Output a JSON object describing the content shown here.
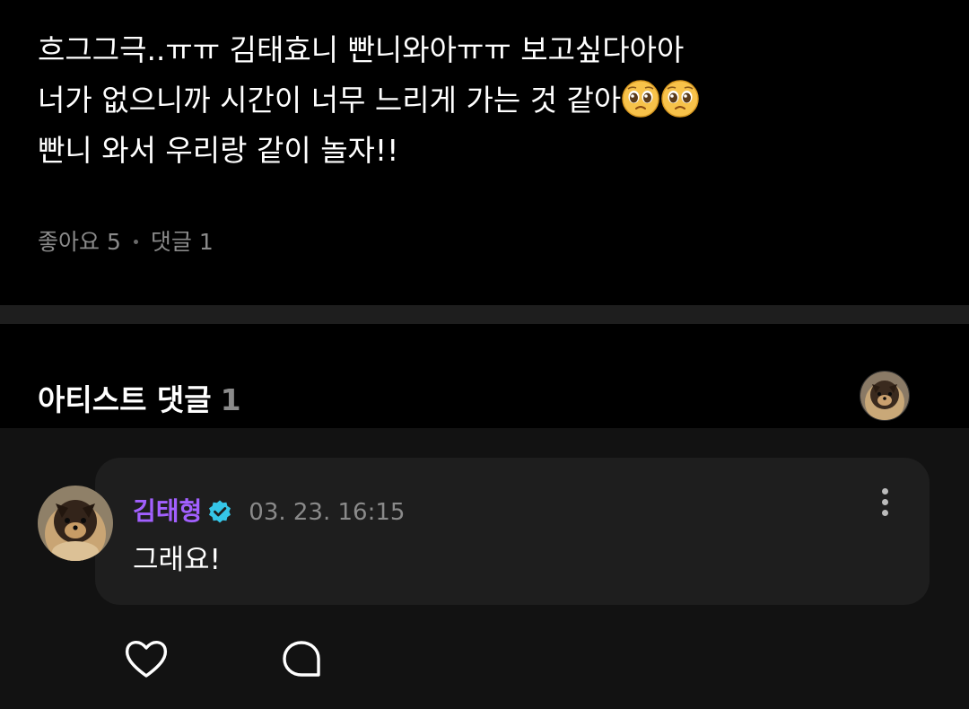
{
  "post": {
    "lines": [
      "흐그그극..ㅠㅠ 김태효니 빤니와아ㅠㅠ 보고싶다아아",
      "너가 없으니까 시간이 너무 느리게 가는 것 같아",
      "빤니 와서 우리랑 같이 놀자!!"
    ],
    "emoji_after_line_2": [
      "pleading-face-emoji",
      "pleading-face-emoji"
    ],
    "likes_label": "좋아요",
    "likes_count": "5",
    "comments_label": "댓글",
    "comments_count": "1"
  },
  "artist_comments": {
    "title": "아티스트 댓글",
    "count": "1"
  },
  "comment": {
    "author": "김태형",
    "verified": true,
    "date": "03. 23. 16:15",
    "text": "그래요!"
  },
  "icons": {
    "like": "heart-outline-icon",
    "reply": "speech-bubble-icon",
    "more": "more-vertical-icon",
    "verified": "verified-badge-icon"
  },
  "colors": {
    "author": "#a260ff",
    "verified_badge": "#35c6e8",
    "muted_text": "#8a8a8a",
    "card_bg": "#1e1e1e"
  }
}
